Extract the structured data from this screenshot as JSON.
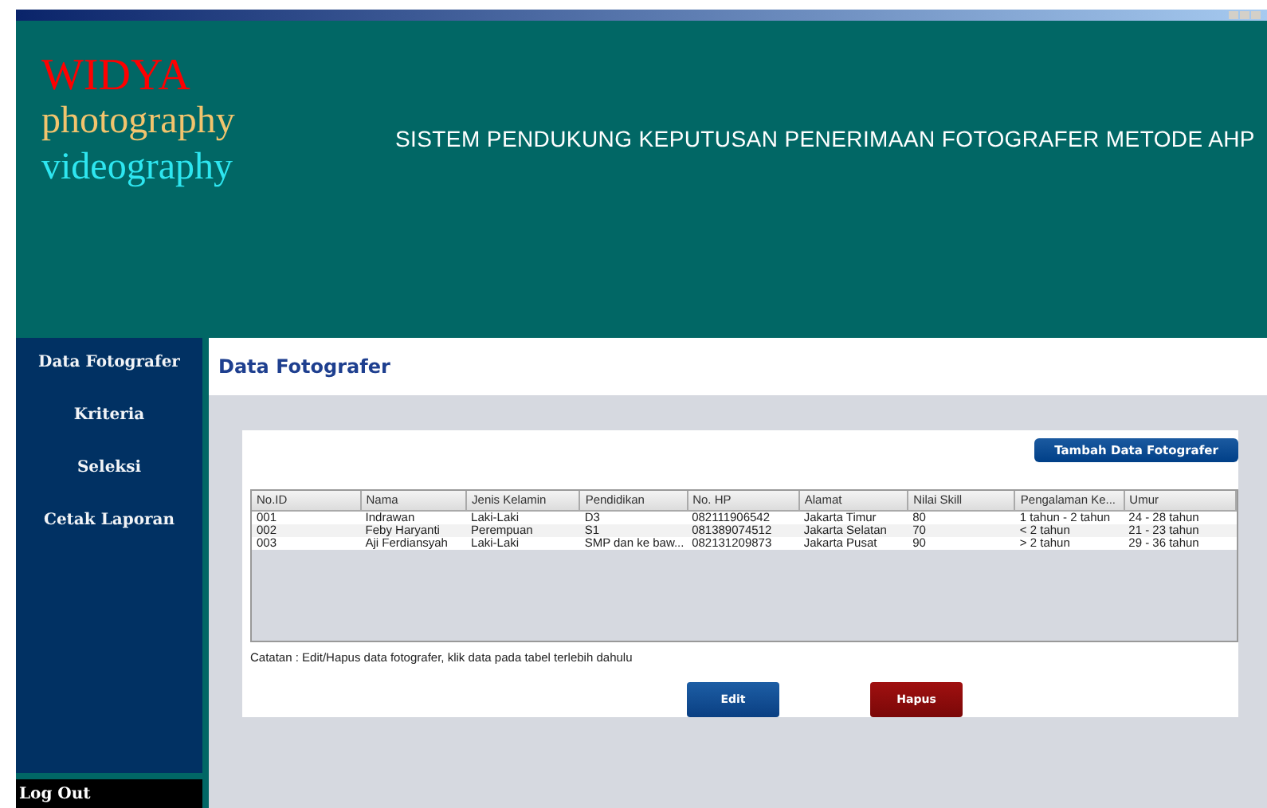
{
  "brand": {
    "name": "WIDYA",
    "line_1": "photography",
    "line_2": "videography"
  },
  "header": {
    "title": "SISTEM PENDUKUNG KEPUTUSAN PENERIMAAN FOTOGRAFER METODE AHP"
  },
  "sidebar": {
    "items": [
      {
        "label": "Data Fotografer"
      },
      {
        "label": "Kriteria"
      },
      {
        "label": "Seleksi"
      },
      {
        "label": "Cetak Laporan"
      }
    ],
    "logout": "Log Out"
  },
  "page": {
    "title": "Data Fotografer",
    "add_button": "Tambah Data Fotografer",
    "note": "Catatan : Edit/Hapus data fotografer, klik data pada tabel terlebih dahulu",
    "buttons": [
      {
        "label": "Edit",
        "kind": "primary"
      },
      {
        "label": "Hapus",
        "kind": "danger"
      }
    ]
  },
  "table": {
    "columns": [
      "No.ID",
      "Nama",
      "Jenis Kelamin",
      "Pendidikan",
      "No. HP",
      "Alamat",
      "Nilai Skill",
      "Pengalaman Ke...",
      "Umur"
    ],
    "rows": [
      [
        "001",
        "Indrawan",
        "Laki-Laki",
        "D3",
        "082111906542",
        "Jakarta Timur",
        "80",
        "1 tahun - 2 tahun",
        "24 - 28 tahun"
      ],
      [
        "002",
        "Feby Haryanti",
        "Perempuan",
        "S1",
        "081389074512",
        "Jakarta Selatan",
        "70",
        "< 2 tahun",
        "21 - 23 tahun"
      ],
      [
        "003",
        "Aji Ferdiansyah",
        "Laki-Laki",
        "SMP dan ke baw...",
        "082131209873",
        "Jakarta Pusat",
        "90",
        "> 2 tahun",
        "29 - 36 tahun"
      ]
    ]
  }
}
